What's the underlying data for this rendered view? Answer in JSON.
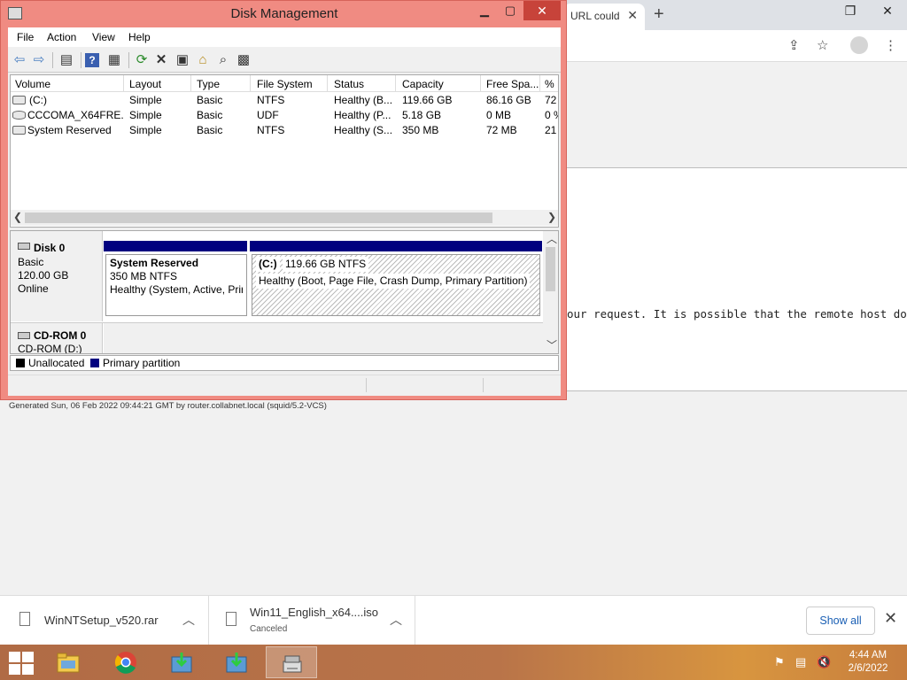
{
  "chrome": {
    "tab_title": "URL could",
    "tab_close": "✕",
    "new_tab": "+",
    "error_text": "our request. It is possible that the remote host does not",
    "generated": "Generated Sun, 06 Feb 2022 09:44:21 GMT by router.collabnet.local (squid/5.2-VCS)"
  },
  "downloads": {
    "items": [
      {
        "name": "WinNTSetup_v520.rar",
        "status": ""
      },
      {
        "name": "Win11_English_x64....iso",
        "status": "Canceled"
      }
    ],
    "show_all": "Show all"
  },
  "taskbar": {
    "time": "4:44 AM",
    "date": "2/6/2022"
  },
  "dm": {
    "title": "Disk Management",
    "menu": [
      "File",
      "Action",
      "View",
      "Help"
    ],
    "columns": [
      "Volume",
      "Layout",
      "Type",
      "File System",
      "Status",
      "Capacity",
      "Free Spa...",
      "% F"
    ],
    "rows": [
      [
        "(C:)",
        "Simple",
        "Basic",
        "NTFS",
        "Healthy (B...",
        "119.66 GB",
        "86.16 GB",
        "72"
      ],
      [
        "CCCOMA_X64FRE...",
        "Simple",
        "Basic",
        "UDF",
        "Healthy (P...",
        "5.18 GB",
        "0 MB",
        "0 %"
      ],
      [
        "System Reserved",
        "Simple",
        "Basic",
        "NTFS",
        "Healthy (S...",
        "350 MB",
        "72 MB",
        "21"
      ]
    ],
    "disk0": {
      "name": "Disk 0",
      "type": "Basic",
      "size": "120.00 GB",
      "state": "Online",
      "partitions": [
        {
          "name": "System Reserved",
          "size": "350 MB NTFS",
          "status": "Healthy (System, Active, Prir"
        },
        {
          "name": "(C:)",
          "size": "119.66 GB NTFS",
          "status": "Healthy (Boot, Page File, Crash Dump, Primary Partition)"
        }
      ]
    },
    "cdrom0": {
      "name": "CD-ROM 0",
      "sub": "CD-ROM (D:)"
    },
    "legend": {
      "unallocated": "Unallocated",
      "primary": "Primary partition"
    }
  }
}
